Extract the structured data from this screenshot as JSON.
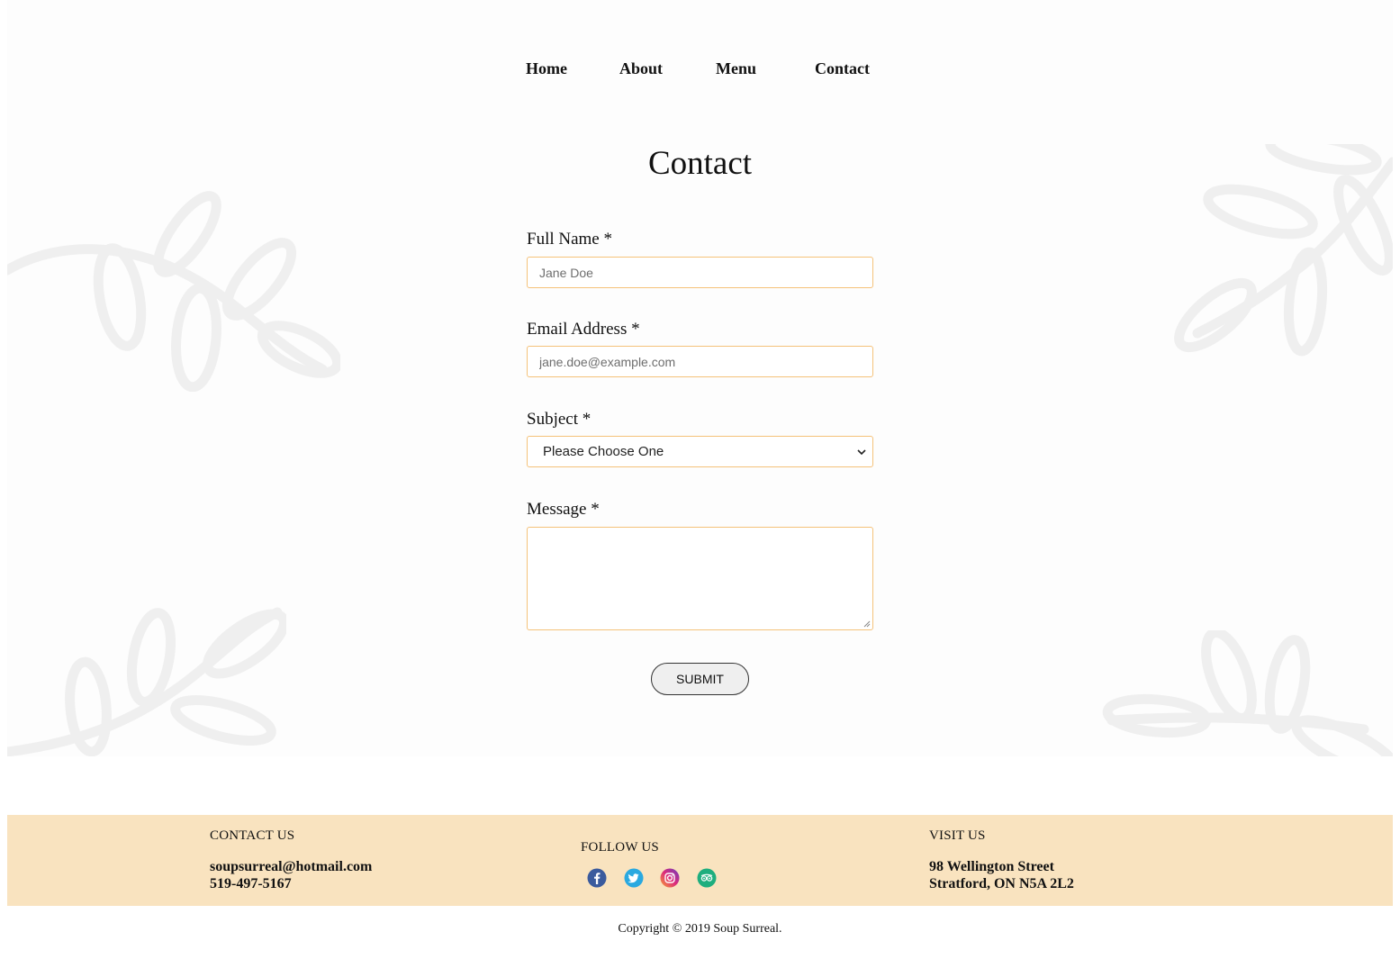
{
  "nav": {
    "items": [
      {
        "label": "Home"
      },
      {
        "label": "About"
      },
      {
        "label": "Menu"
      },
      {
        "label": "Contact"
      }
    ]
  },
  "main": {
    "title": "Contact",
    "form": {
      "full_name": {
        "label": "Full Name *",
        "placeholder": "Jane Doe"
      },
      "email": {
        "label": "Email Address *",
        "placeholder": "jane.doe@example.com"
      },
      "subject": {
        "label": "Subject *",
        "selected": "Please Choose One"
      },
      "message": {
        "label": "Message *",
        "value": ""
      },
      "submit_label": "SUBMIT"
    }
  },
  "footer": {
    "contact": {
      "heading": "CONTACT US",
      "email": "soupsurreal@hotmail.com",
      "phone": "519-497-5167"
    },
    "follow": {
      "heading": "FOLLOW US",
      "icons": [
        "facebook-icon",
        "twitter-icon",
        "instagram-icon",
        "tripadvisor-icon"
      ]
    },
    "visit": {
      "heading": "VISIT US",
      "street": "98 Wellington Street",
      "city": "Stratford, ON N5A 2L2"
    },
    "copyright": "Copyright © 2019 Soup Surreal."
  },
  "colors": {
    "accent_border": "#f5c27a",
    "footer_bg": "#f9e3bf",
    "decor": "#efefef"
  }
}
